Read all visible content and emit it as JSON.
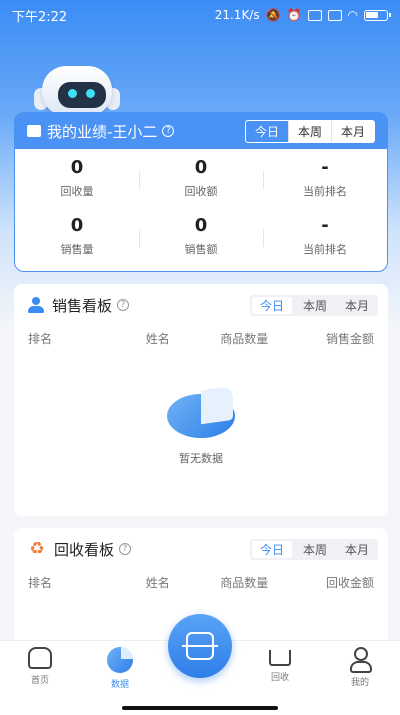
{
  "status_bar": {
    "time": "下午2:22",
    "net_speed": "21.1K/s",
    "icons": [
      "silent-icon",
      "alarm-icon",
      "signal-hd-icon",
      "signal-hd-icon",
      "wifi-icon",
      "battery-icon"
    ]
  },
  "performance": {
    "title": "我的业绩-王小二",
    "tabs": [
      "今日",
      "本周",
      "本月"
    ],
    "active_tab": "今日",
    "rows": [
      [
        {
          "value": "0",
          "label": "回收量"
        },
        {
          "value": "0",
          "label": "回收额"
        },
        {
          "value": "-",
          "label": "当前排名"
        }
      ],
      [
        {
          "value": "0",
          "label": "销售量"
        },
        {
          "value": "0",
          "label": "销售额"
        },
        {
          "value": "-",
          "label": "当前排名"
        }
      ]
    ]
  },
  "sales_board": {
    "title": "销售看板",
    "tabs": [
      "今日",
      "本周",
      "本月"
    ],
    "columns": [
      "排名",
      "姓名",
      "商品数量",
      "销售金额"
    ],
    "empty_text": "暂无数据"
  },
  "recycle_board": {
    "title": "回收看板",
    "tabs": [
      "今日",
      "本周",
      "本月"
    ],
    "columns": [
      "排名",
      "姓名",
      "商品数量",
      "回收金额"
    ]
  },
  "bottom_nav": {
    "items": [
      {
        "label": "首页",
        "icon": "home-icon"
      },
      {
        "label": "数据",
        "icon": "data-icon",
        "active": true
      },
      {
        "label": "回收",
        "icon": "cart-icon"
      },
      {
        "label": "我的",
        "icon": "profile-icon"
      }
    ]
  },
  "colors": {
    "accent": "#3b8cf5",
    "recycle": "#f07a3c"
  }
}
